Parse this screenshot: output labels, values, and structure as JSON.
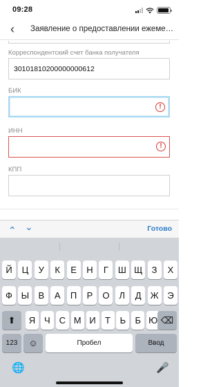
{
  "status_bar": {
    "time": "09:28",
    "battery_level": 0.95
  },
  "nav": {
    "back_icon": "‹",
    "title": "Заявление о предоставлении ежеме…"
  },
  "form": {
    "fields": [
      {
        "label": "Корреспондентский счет банка получателя",
        "value": "30101810200000000612",
        "state": "normal"
      },
      {
        "label": "БИК",
        "value": "",
        "state": "focused-error"
      },
      {
        "label": "ИНН",
        "value": "",
        "state": "error"
      },
      {
        "label": "КПП",
        "value": "",
        "state": "normal"
      }
    ],
    "error_icon": "!"
  },
  "keyboard_accessory": {
    "up_icon": "⌃",
    "down_icon": "⌄",
    "done_label": "Готово"
  },
  "keyboard": {
    "row1": [
      "Й",
      "Ц",
      "У",
      "К",
      "Е",
      "Н",
      "Г",
      "Ш",
      "Щ",
      "З",
      "Х"
    ],
    "row2": [
      "Ф",
      "Ы",
      "В",
      "А",
      "П",
      "Р",
      "О",
      "Л",
      "Д",
      "Ж",
      "Э"
    ],
    "row3": [
      "Я",
      "Ч",
      "С",
      "М",
      "И",
      "Т",
      "Ь",
      "Б",
      "Ю"
    ],
    "shift_icon": "⬆",
    "backspace_icon": "⌫",
    "numbers_label": "123",
    "emoji_icon": "☺",
    "space_label": "Пробел",
    "return_label": "Ввод",
    "globe_icon": "🌐",
    "mic_icon": "🎤"
  }
}
